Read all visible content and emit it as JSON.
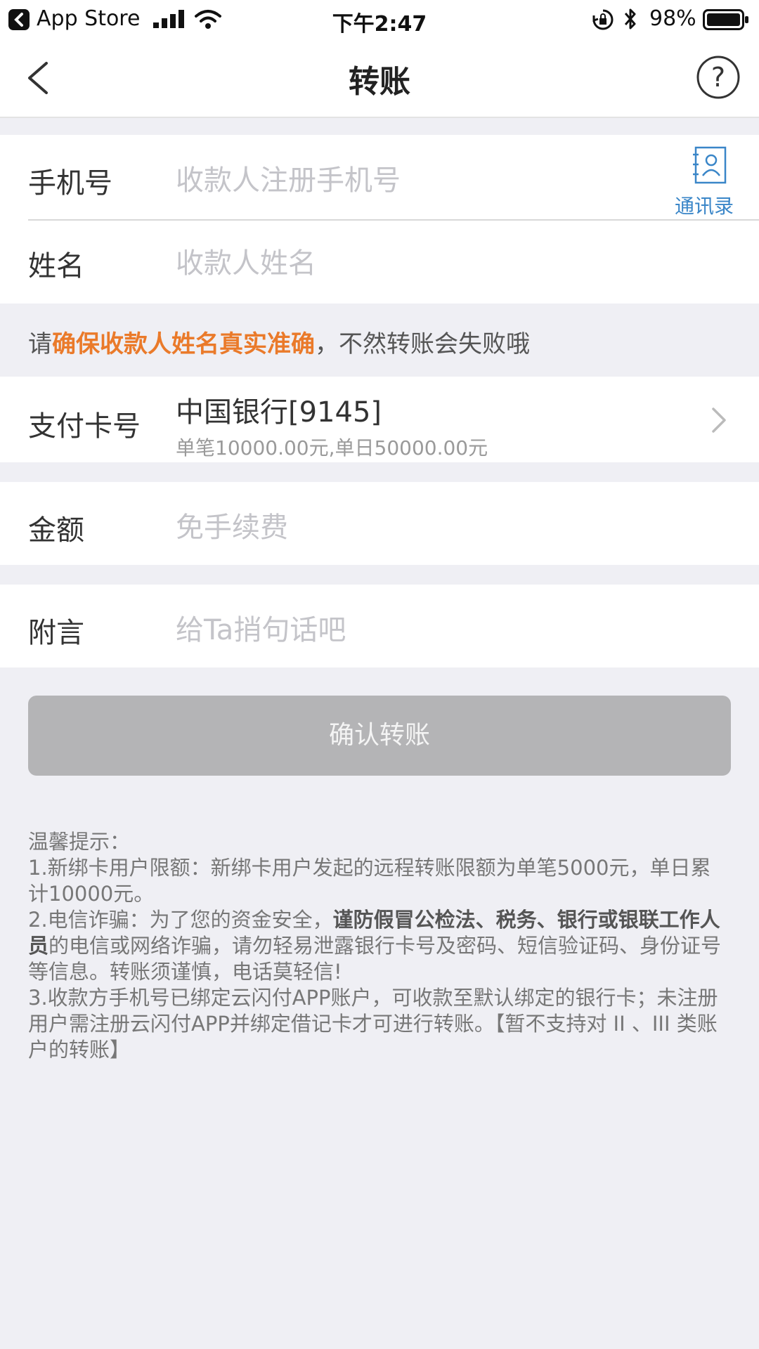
{
  "status_bar": {
    "back_app": "App Store",
    "time": "下午2:47",
    "battery": "98%"
  },
  "nav": {
    "title": "转账"
  },
  "form": {
    "phone_label": "手机号",
    "phone_placeholder": "收款人注册手机号",
    "contacts_label": "通讯录",
    "name_label": "姓名",
    "name_placeholder": "收款人姓名"
  },
  "notice": {
    "prefix": "请",
    "highlight": "确保收款人姓名真实准确",
    "suffix": "，不然转账会失败哦"
  },
  "card": {
    "label": "支付卡号",
    "bank": "中国银行[9145]",
    "limit": "单笔10000.00元,单日50000.00元"
  },
  "amount": {
    "label": "金额",
    "placeholder": "免手续费"
  },
  "memo": {
    "label": "附言",
    "placeholder": "给Ta捎句话吧"
  },
  "confirm_button": "确认转账",
  "tips": {
    "title": "温馨提示：",
    "item1": "1.新绑卡用户限额：新绑卡用户发起的远程转账限额为单笔5000元，单日累计10000元。",
    "item2_prefix": "2.电信诈骗：为了您的资金安全，",
    "item2_bold": "谨防假冒公检法、税务、银行或银联工作人员",
    "item2_suffix": "的电信或网络诈骗，请勿轻易泄露银行卡号及密码、短信验证码、身份证号等信息。转账须谨慎，电话莫轻信!",
    "item3": "3.收款方手机号已绑定云闪付APP账户，可收款至默认绑定的银行卡；未注册用户需注册云闪付APP并绑定借记卡才可进行转账。【暂不支持对 II 、III 类账户的转账】"
  },
  "colors": {
    "background": "#efeff4",
    "highlight": "#ea7a2a",
    "link_blue": "#3a86c8",
    "button_disabled": "#b4b4b6"
  }
}
